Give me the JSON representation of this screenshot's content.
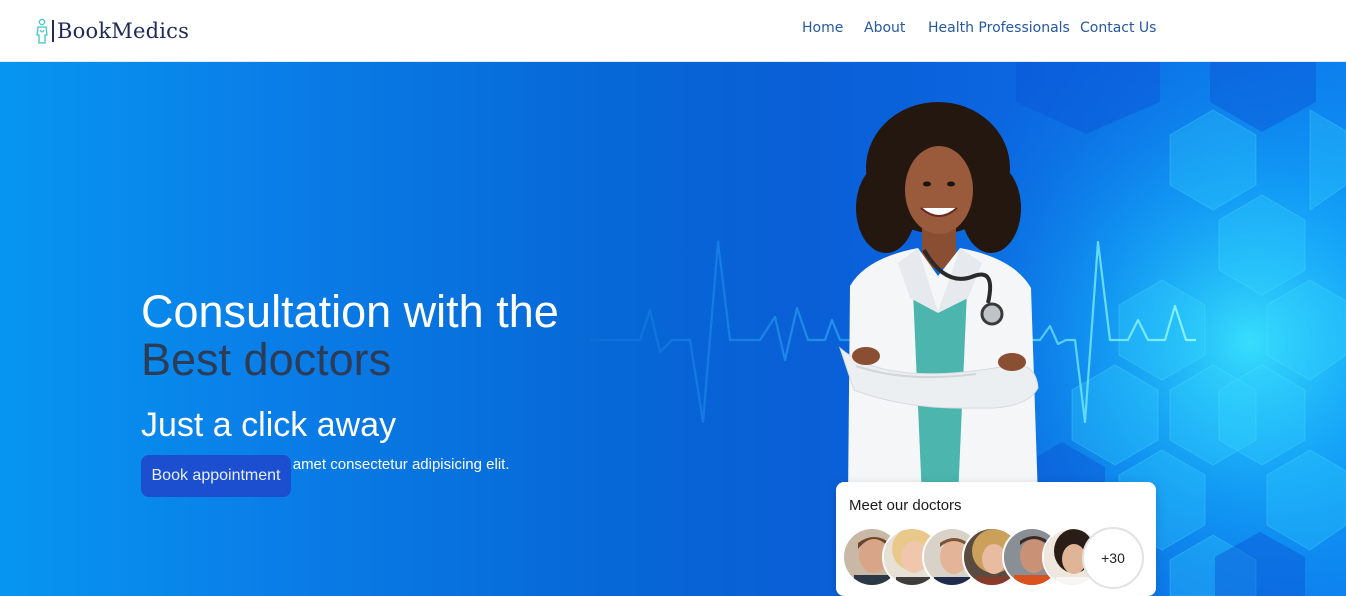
{
  "header": {
    "brand": "BookMedics",
    "nav": [
      "Home",
      "About",
      "Health Professionals",
      "Contact Us"
    ]
  },
  "hero": {
    "title_line1": "Consultation with the",
    "title_line2": "Best doctors",
    "subtitle": "Just a click away",
    "description": "Lorem ipsum, dolor sit amet consectetur adipisicing elit.",
    "cta_label": "Book appointment"
  },
  "doctors_card": {
    "title": "Meet our doctors",
    "more_count": "+30"
  },
  "colors": {
    "brand_text": "#1f2a57",
    "nav_text": "#24589f",
    "cta_bg": "#1b4fcf",
    "headline_dark": "#2c3c57",
    "logo_accent": "#3fc7c7"
  }
}
